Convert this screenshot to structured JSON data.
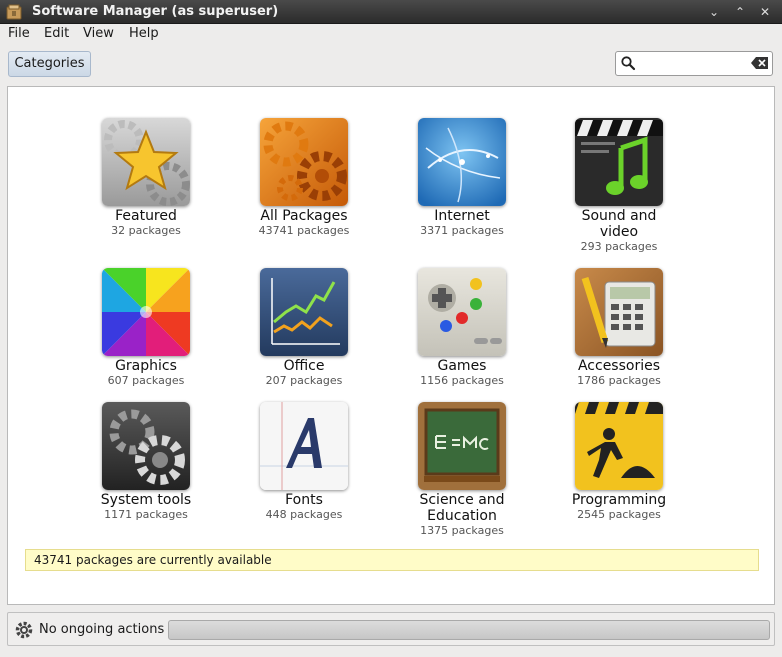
{
  "window": {
    "title": "Software Manager (as superuser)",
    "controls": [
      "minimize",
      "maximize",
      "close"
    ]
  },
  "menubar": {
    "items": [
      "File",
      "Edit",
      "View",
      "Help"
    ]
  },
  "toolbar": {
    "categories_label": "Categories",
    "search_value": ""
  },
  "categories": [
    {
      "label": "Featured",
      "count": "32 packages",
      "icon": "star-icon"
    },
    {
      "label": "All Packages",
      "count": "43741 packages",
      "icon": "gears-icon"
    },
    {
      "label": "Internet",
      "count": "3371 packages",
      "icon": "globe-icon"
    },
    {
      "label": "Sound and video",
      "count": "293 packages",
      "icon": "clapper-music-icon"
    },
    {
      "label": "Graphics",
      "count": "607 packages",
      "icon": "color-wheel-icon"
    },
    {
      "label": "Office",
      "count": "207 packages",
      "icon": "chart-icon"
    },
    {
      "label": "Games",
      "count": "1156 packages",
      "icon": "gamepad-icon"
    },
    {
      "label": "Accessories",
      "count": "1786 packages",
      "icon": "calculator-icon"
    },
    {
      "label": "System tools",
      "count": "1171 packages",
      "icon": "system-gears-icon"
    },
    {
      "label": "Fonts",
      "count": "448 packages",
      "icon": "font-icon"
    },
    {
      "label": "Science and Education",
      "count": "1375 packages",
      "icon": "chalkboard-icon"
    },
    {
      "label": "Programming",
      "count": "2545 packages",
      "icon": "construction-icon"
    }
  ],
  "info": {
    "message": "43741 packages are currently available"
  },
  "status": {
    "text": "No ongoing actions",
    "progress": 0
  },
  "colors": {
    "titlebar": "#333333",
    "info_background": "#fffcc8",
    "category_button": "#d6e0ec"
  }
}
